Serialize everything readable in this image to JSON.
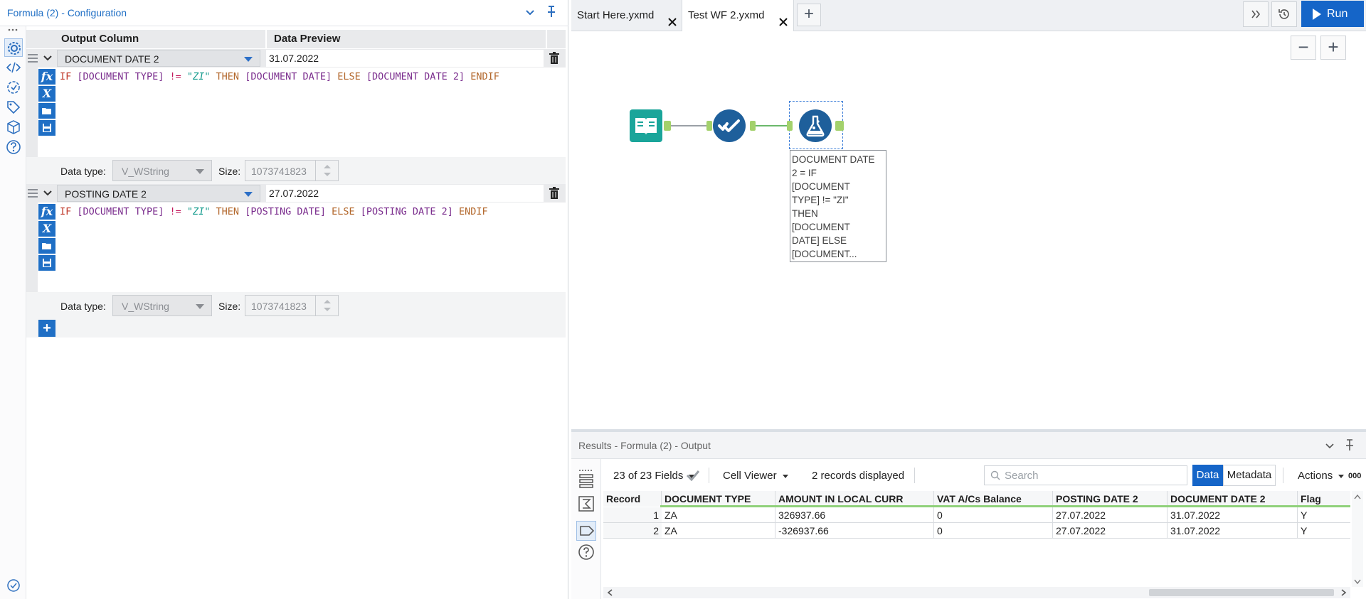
{
  "config": {
    "title": "Formula (2) - Configuration",
    "grid_headers": {
      "output_column": "Output Column",
      "data_preview": "Data Preview"
    },
    "expressions": [
      {
        "column": "DOCUMENT DATE 2",
        "preview": "31.07.2022",
        "tokens": [
          "IF",
          "[DOCUMENT TYPE]",
          "!=",
          "\"ZI\"",
          "THEN",
          "[DOCUMENT DATE]",
          "ELSE",
          "[DOCUMENT DATE 2]",
          "ENDIF"
        ],
        "data_type_label": "Data type:",
        "data_type": "V_WString",
        "size_label": "Size:",
        "size": "1073741823"
      },
      {
        "column": "POSTING DATE 2",
        "preview": "27.07.2022",
        "tokens": [
          "IF",
          "[DOCUMENT TYPE]",
          "!=",
          "\"ZI\"",
          "THEN",
          "[POSTING DATE]",
          "ELSE",
          "[POSTING DATE 2]",
          "ENDIF"
        ],
        "data_type_label": "Data type:",
        "data_type": "V_WString",
        "size_label": "Size:",
        "size": "1073741823"
      }
    ],
    "tool_buttons": [
      "fx",
      "X"
    ],
    "add_label": "+"
  },
  "tabs": [
    {
      "label": "Start Here.yxmd",
      "active": false
    },
    {
      "label": "Test WF 2.yxmd",
      "active": true
    }
  ],
  "toolbar": {
    "run_label": "Run"
  },
  "canvas": {
    "annotation": [
      "DOCUMENT DATE",
      "2 = IF",
      "[DOCUMENT",
      "TYPE] != \"ZI\"",
      "THEN",
      "[DOCUMENT",
      "DATE] ELSE",
      "[DOCUMENT..."
    ],
    "colors": {
      "input_node": "#1aa59a",
      "select_node": "#1e5f9b",
      "formula_node": "#1e5f9b",
      "anchor": "#a3d16b"
    }
  },
  "results": {
    "title": "Results - Formula (2) - Output",
    "fields_label": "23 of 23 Fields",
    "cell_viewer_label": "Cell Viewer",
    "records_label": "2 records displayed",
    "search_placeholder": "Search",
    "data_tab": "Data",
    "metadata_tab": "Metadata",
    "actions_label": "Actions",
    "more_label": "000",
    "columns": [
      "Record",
      "DOCUMENT TYPE",
      "AMOUNT IN LOCAL CURR",
      "VAT A/Cs Balance",
      "POSTING DATE 2",
      "DOCUMENT DATE 2",
      "Flag"
    ],
    "rows": [
      [
        "1",
        "ZA",
        "326937.66",
        "0",
        "27.07.2022",
        "31.07.2022",
        "Y"
      ],
      [
        "2",
        "ZA",
        "-326937.66",
        "0",
        "27.07.2022",
        "31.07.2022",
        "Y"
      ]
    ]
  }
}
